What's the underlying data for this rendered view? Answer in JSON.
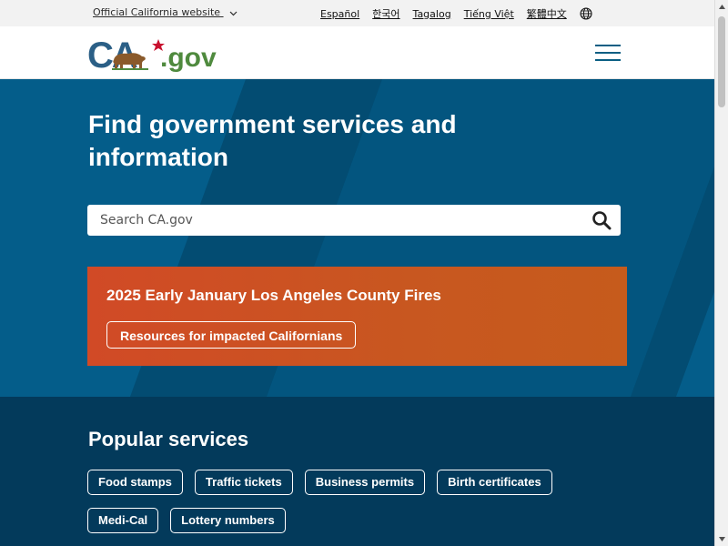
{
  "utility_bar": {
    "official_label": "Official California website",
    "languages": [
      "Español",
      "한국어",
      "Tagalog",
      "Tiếng Việt",
      "繁體中文"
    ],
    "globe_icon": "globe-icon"
  },
  "header": {
    "logo_ca": "CA",
    "logo_gov": ".gov",
    "menu_icon": "hamburger-menu-icon"
  },
  "hero": {
    "title": "Find government services and information",
    "search": {
      "placeholder": "Search CA.gov",
      "value": "",
      "icon": "search-icon"
    }
  },
  "alert": {
    "title": "2025 Early January Los Angeles County Fires",
    "button_label": "Resources for impacted Californians"
  },
  "popular": {
    "title": "Popular services",
    "services": [
      "Food stamps",
      "Traffic tickets",
      "Business permits",
      "Birth certificates",
      "Medi-Cal",
      "Lottery numbers"
    ]
  },
  "colors": {
    "hero_bg": "#045d8a",
    "popular_bg": "#033a5b",
    "alert_bg": "#c85720",
    "logo_blue": "#2b5f86",
    "logo_green": "#4f8a3e",
    "star_red": "#c8102e"
  }
}
